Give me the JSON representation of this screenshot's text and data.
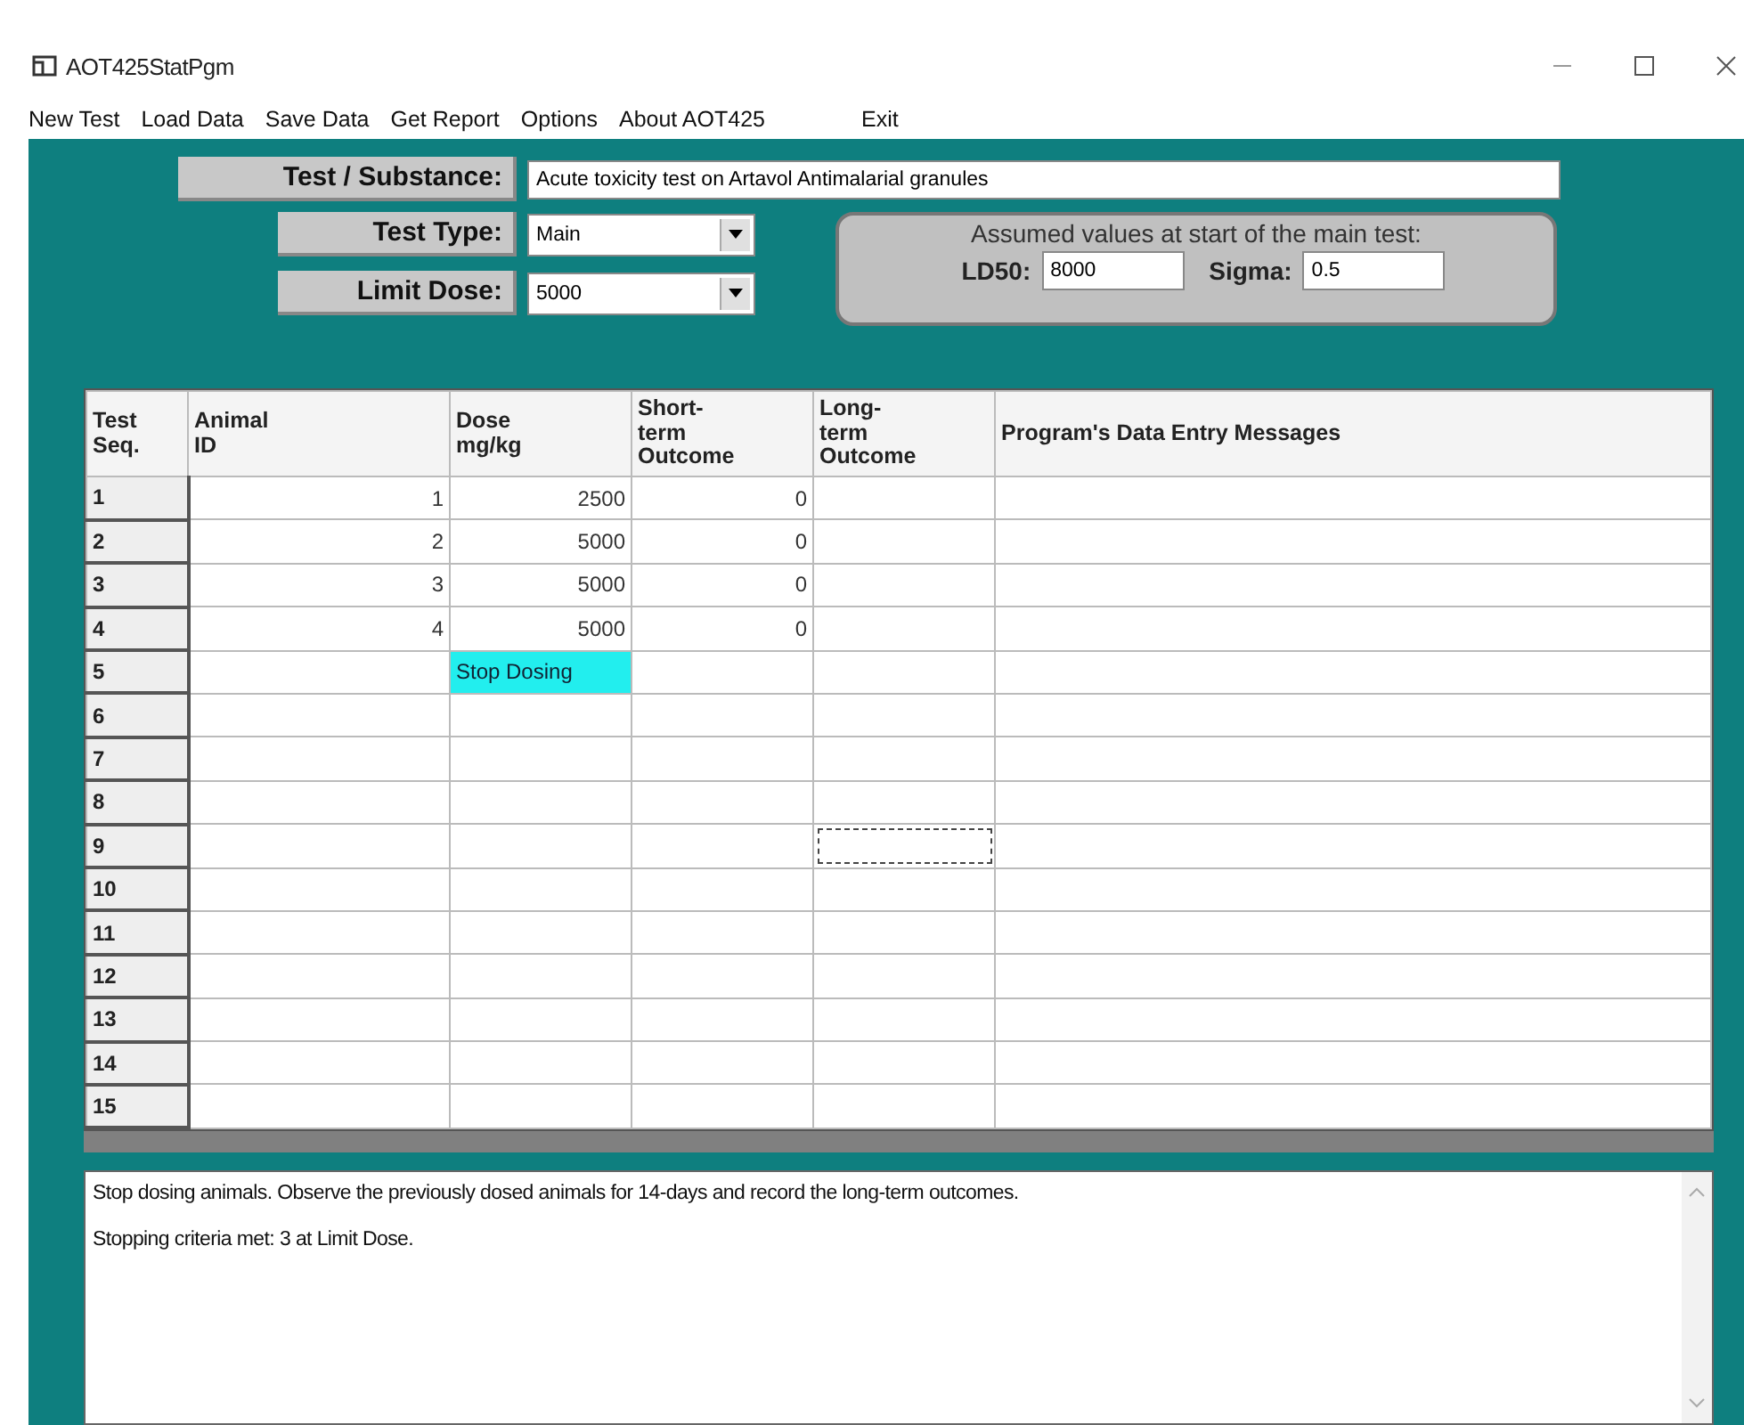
{
  "window": {
    "title": "AOT425StatPgm"
  },
  "menu": [
    "New Test",
    "Load Data",
    "Save Data",
    "Get Report",
    "Options",
    "About AOT425",
    "Exit"
  ],
  "substance": {
    "label": "Test / Substance:",
    "value": "Acute toxicity test on Artavol Antimalarial granules"
  },
  "test_type": {
    "label": "Test Type:",
    "value": "Main"
  },
  "limit_dose": {
    "label": "Limit Dose:",
    "value": "5000"
  },
  "assumed": {
    "title": "Assumed values at start of the main test:",
    "ld50_label": "LD50:",
    "ld50": "8000",
    "sigma_label": "Sigma:",
    "sigma": "0.5"
  },
  "table": {
    "columns": [
      "Test Seq.",
      "Animal ID",
      "Dose mg/kg",
      "Short-term Outcome",
      "Long-term Outcome",
      "Program's Data Entry Messages"
    ],
    "rows": [
      {
        "cells": [
          {
            "text": "1"
          },
          {
            "text": "1"
          },
          {
            "text": "2500"
          },
          {
            "text": "0"
          },
          {},
          {}
        ]
      },
      {
        "cells": [
          {
            "text": "2"
          },
          {
            "text": "2"
          },
          {
            "text": "5000"
          },
          {
            "text": "0"
          },
          {},
          {}
        ]
      },
      {
        "cells": [
          {
            "text": "3"
          },
          {
            "text": "3"
          },
          {
            "text": "5000"
          },
          {
            "text": "0"
          },
          {},
          {}
        ]
      },
      {
        "cells": [
          {
            "text": "4"
          },
          {
            "text": "4"
          },
          {
            "text": "5000"
          },
          {
            "text": "0"
          },
          {},
          {}
        ]
      },
      {
        "cells": [
          {
            "text": "5"
          },
          {},
          {
            "text": "Stop Dosing",
            "highlighted": true
          },
          {},
          {},
          {}
        ]
      },
      {
        "cells": [
          {
            "text": "6"
          },
          {},
          {},
          {},
          {},
          {}
        ]
      },
      {
        "cells": [
          {
            "text": "7"
          },
          {},
          {},
          {},
          {},
          {}
        ]
      },
      {
        "cells": [
          {
            "text": "8"
          },
          {},
          {},
          {},
          {},
          {}
        ]
      },
      {
        "cells": [
          {
            "text": "9"
          },
          {},
          {},
          {},
          {
            "focused": true
          },
          {}
        ]
      },
      {
        "cells": [
          {
            "text": "10"
          },
          {},
          {},
          {},
          {},
          {}
        ]
      },
      {
        "cells": [
          {
            "text": "11"
          },
          {},
          {},
          {},
          {},
          {}
        ]
      },
      {
        "cells": [
          {
            "text": "12"
          },
          {},
          {},
          {},
          {},
          {}
        ]
      },
      {
        "cells": [
          {
            "text": "13"
          },
          {},
          {},
          {},
          {},
          {}
        ]
      },
      {
        "cells": [
          {
            "text": "14"
          },
          {},
          {},
          {},
          {},
          {}
        ]
      },
      {
        "cells": [
          {
            "text": "15"
          },
          {},
          {},
          {},
          {},
          {}
        ]
      }
    ]
  },
  "messages": [
    "Stop dosing animals. Observe the previously dosed animals for 14-days and record the long-term outcomes.",
    "Stopping criteria met: 3 at Limit Dose."
  ]
}
